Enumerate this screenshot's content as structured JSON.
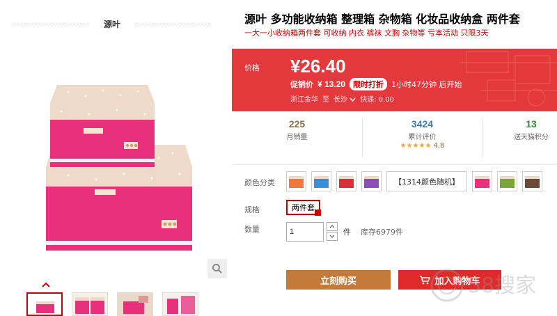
{
  "gallery": {
    "shop_name": "源叶",
    "main_image_alt": "product-main",
    "thumbnails": [
      "thumb-1",
      "thumb-2",
      "thumb-3",
      "thumb-4"
    ]
  },
  "product": {
    "title": "源叶 多功能收纳箱 整理箱 杂物箱 化妆品收纳盒 两件套",
    "subtitle": "一大一小收纳箱两件套 可收纳 内衣 裤袜 文胸 杂物等 亏本活动 只限3天"
  },
  "price": {
    "label": "价格",
    "value": "¥26.40",
    "promo_label": "促销价",
    "promo_price": "¥ 13.20",
    "flash_badge": "限时打折",
    "countdown": "1小时47分钟 后开始",
    "origin": "浙江金华",
    "to_label": "至",
    "destination": "长沙",
    "shipping": "快递: 0.00"
  },
  "stats": {
    "monthly_sales": {
      "value": "225",
      "label": "月销量"
    },
    "reviews": {
      "value": "3424",
      "label": "累计评价",
      "stars": "★★★★★",
      "score": "4.8"
    },
    "points": {
      "value": "13",
      "label": "送天猫积分"
    }
  },
  "options": {
    "color_label": "颜色分类",
    "color_swatches": [
      "orange",
      "blue",
      "red",
      "purple"
    ],
    "color_text_option": "【1314颜色随机】",
    "color_swatches_after": [
      "pink",
      "green",
      "brown"
    ],
    "spec_label": "规格",
    "spec_value": "两件套",
    "qty_label": "数量",
    "qty_value": "1",
    "qty_unit": "件",
    "stock": "库存6979件"
  },
  "actions": {
    "buy_now": "立刻购买",
    "add_to_cart": "加入购物车"
  },
  "colors": {
    "price_bg": "#e4393c",
    "buy_btn": "#c67a3a",
    "cart_btn": "#e02a2a",
    "accent": "#c40000"
  },
  "watermark": {
    "text": "58搜家"
  }
}
